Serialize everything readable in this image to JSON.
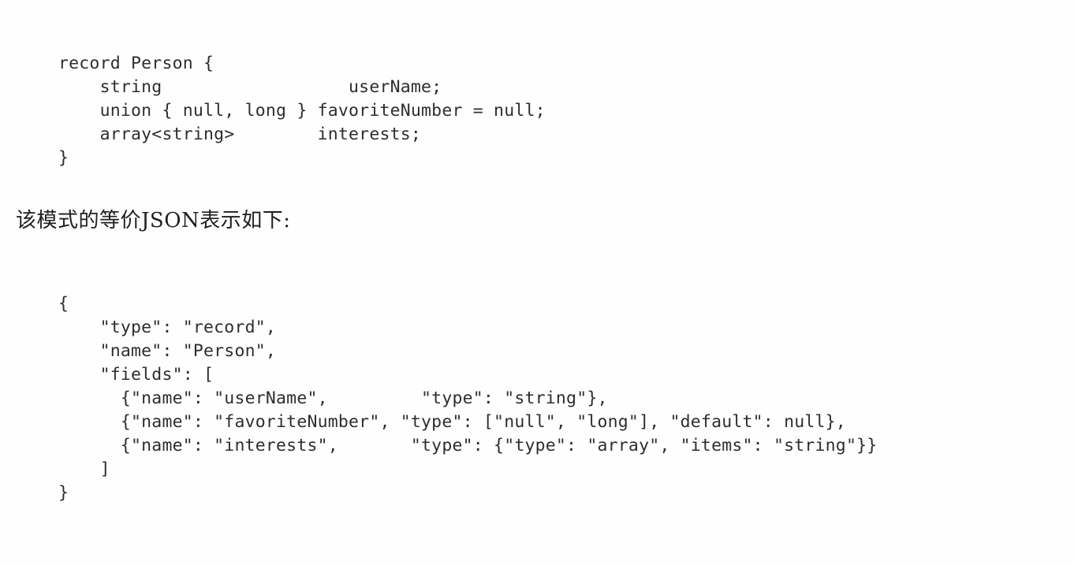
{
  "page": {
    "background_color": "#fefefe",
    "text_color": "#2e2e2e"
  },
  "avro_schema_block": {
    "language": "avro-idl",
    "lines": [
      "record Person {",
      "    string                  userName;",
      "    union { null, long } favoriteNumber = null;",
      "    array<string>        interests;",
      "}"
    ],
    "full_text": "record Person {\n    string                  userName;\n    union { null, long } favoriteNumber = null;\n    array<string>        interests;\n}"
  },
  "prose_paragraph": {
    "text": "该模式的等价JSON表示如下:"
  },
  "json_schema_block": {
    "language": "json",
    "lines": [
      "{",
      "    \"type\": \"record\",",
      "    \"name\": \"Person\",",
      "    \"fields\": [",
      "      {\"name\": \"userName\",         \"type\": \"string\"},",
      "      {\"name\": \"favoriteNumber\", \"type\": [\"null\", \"long\"], \"default\": null},",
      "      {\"name\": \"interests\",       \"type\": {\"type\": \"array\", \"items\": \"string\"}}",
      "    ]",
      "}"
    ],
    "full_text": "{\n    \"type\": \"record\",\n    \"name\": \"Person\",\n    \"fields\": [\n      {\"name\": \"userName\",         \"type\": \"string\"},\n      {\"name\": \"favoriteNumber\", \"type\": [\"null\", \"long\"], \"default\": null},\n      {\"name\": \"interests\",       \"type\": {\"type\": \"array\", \"items\": \"string\"}}\n    ]\n}",
    "values": {
      "type": "record",
      "name": "Person",
      "field_names": [
        "userName",
        "favoriteNumber",
        "interests"
      ],
      "field_types": [
        "string",
        "[\"null\", \"long\"]",
        "{\"type\": \"array\", \"items\": \"string\"}"
      ],
      "field_defaults": [
        "",
        "null",
        ""
      ]
    }
  }
}
